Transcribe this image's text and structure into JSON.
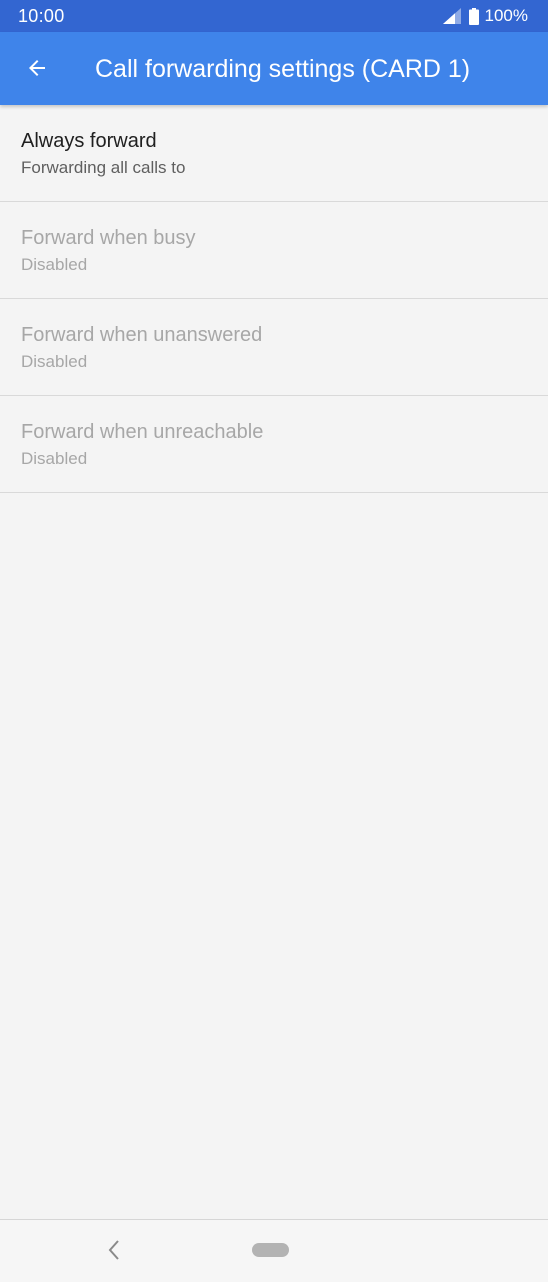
{
  "status_bar": {
    "time": "10:00",
    "battery_text": "100%",
    "icons": [
      "signal-icon",
      "battery-icon"
    ],
    "background": "#3366d1"
  },
  "app_bar": {
    "back_icon": "arrow-back-icon",
    "title": "Call forwarding settings (CARD 1)",
    "background": "#3f84ea"
  },
  "settings": [
    {
      "title": "Always forward",
      "subtitle": "Forwarding all calls to",
      "enabled": true
    },
    {
      "title": "Forward when busy",
      "subtitle": "Disabled",
      "enabled": false
    },
    {
      "title": "Forward when unanswered",
      "subtitle": "Disabled",
      "enabled": false
    },
    {
      "title": "Forward when unreachable",
      "subtitle": "Disabled",
      "enabled": false
    }
  ],
  "nav_bar": {
    "icons": [
      "nav-back-icon",
      "home-pill-icon"
    ]
  }
}
